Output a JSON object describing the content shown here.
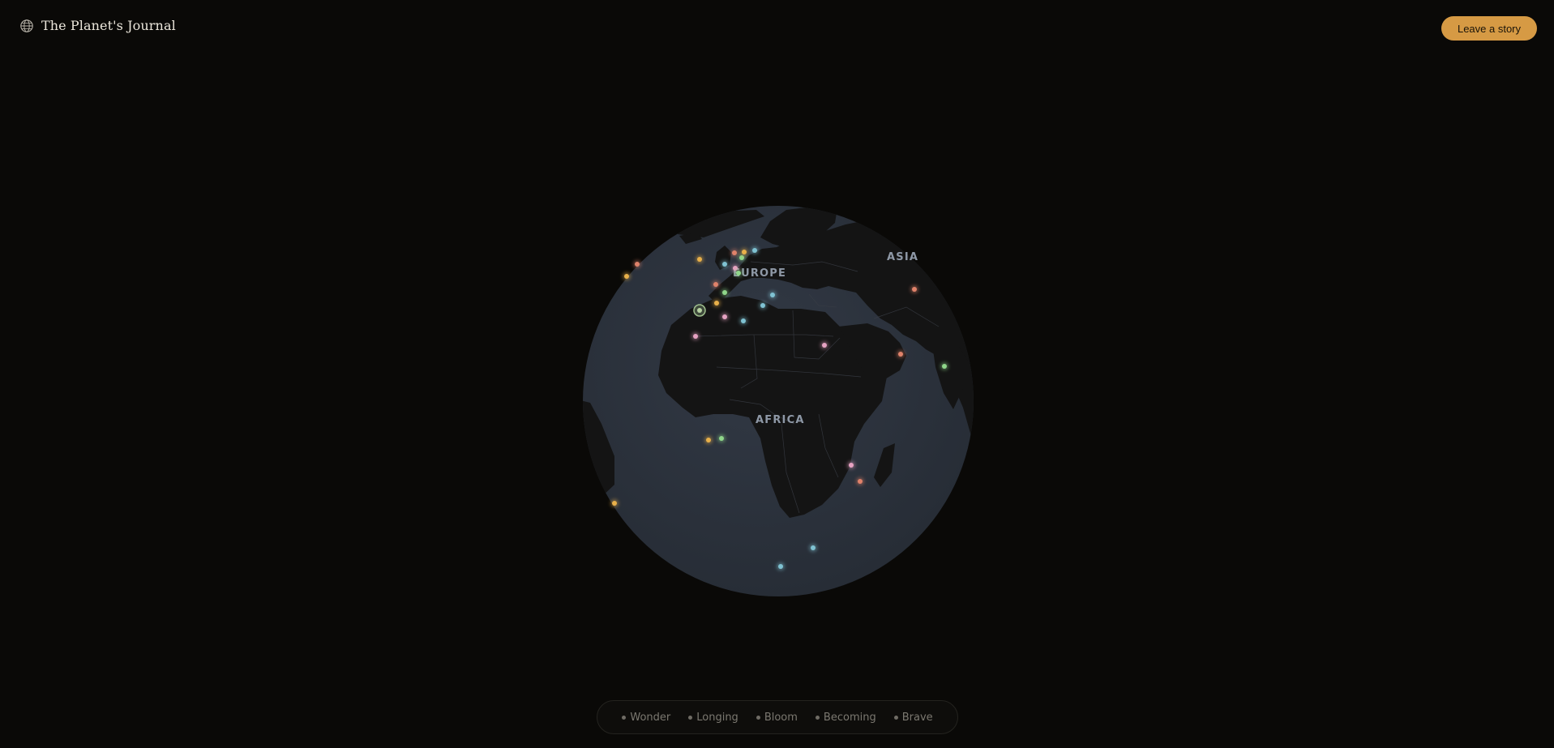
{
  "header": {
    "brand_icon": "globe-icon",
    "title": "The Planet's Journal",
    "cta_label": "Leave a story"
  },
  "colors": {
    "background": "#0a0907",
    "ocean": "#2c323c",
    "land": "#141414",
    "accent": "#d69a44",
    "wonder": "#e8b04a",
    "longing": "#e0826a",
    "bloom": "#8fd68a",
    "becoming": "#e6a2c2",
    "brave": "#7fc2d2"
  },
  "globe": {
    "regions": [
      {
        "key": "europe",
        "label": "EUROPE"
      },
      {
        "key": "asia",
        "label": "ASIA"
      },
      {
        "key": "africa",
        "label": "AFRICA"
      }
    ]
  },
  "legend": {
    "items": [
      {
        "label": "Wonder"
      },
      {
        "label": "Longing"
      },
      {
        "label": "Bloom"
      },
      {
        "label": "Becoming"
      },
      {
        "label": "Brave"
      }
    ]
  }
}
